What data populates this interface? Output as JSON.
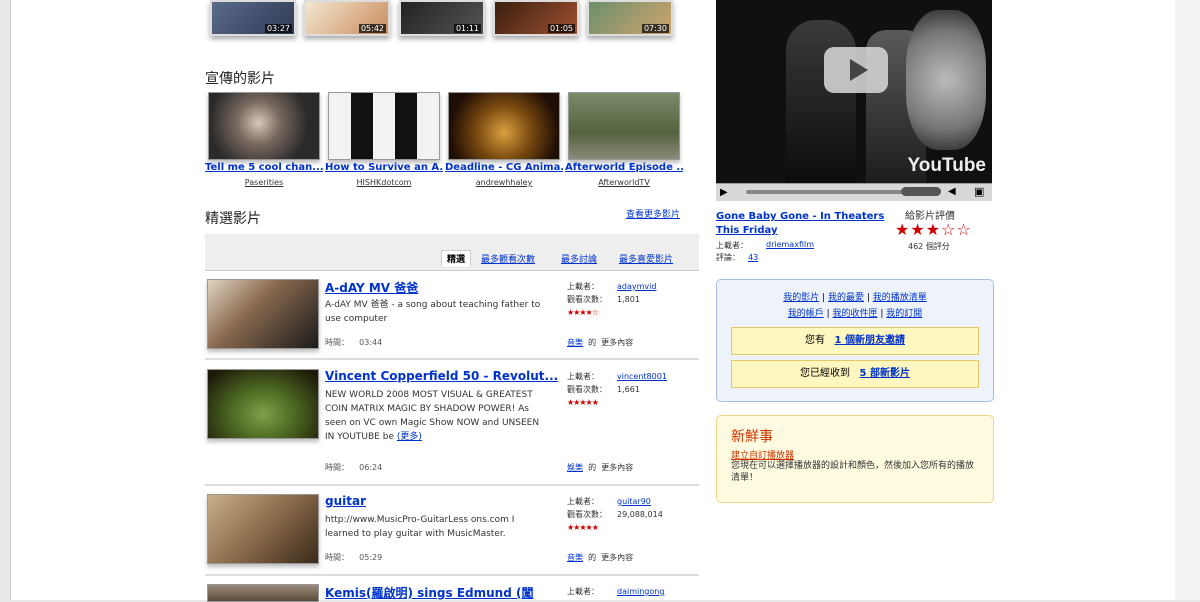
{
  "colors": {
    "link": "#0033cc",
    "star": "#cc0000",
    "accent_red": "#cc3300"
  },
  "top_strip": {
    "durations": [
      "03:27",
      "05:42",
      "01:11",
      "01:05",
      "07:30"
    ]
  },
  "promoted": {
    "title": "宣傳的影片",
    "items": [
      {
        "title": "Tell me 5 cool chan...",
        "user": "Paserities"
      },
      {
        "title": "How to Survive an A...",
        "user": "HISHKdotcom"
      },
      {
        "title": "Deadline - CG Anima...",
        "user": "andrewhhaley"
      },
      {
        "title": "Afterworld Episode ...",
        "user": "AfterworldTV"
      }
    ]
  },
  "featured": {
    "title": "精選影片",
    "see_more": "查看更多影片",
    "tabs": [
      "精選",
      "最多觀看次數",
      "最多討論",
      "最多喜愛影片"
    ],
    "labels": {
      "time": "時間：",
      "uploader": "上載者：",
      "views": "觀看次數：",
      "more": "更多內容",
      "of": "的"
    },
    "videos": [
      {
        "title": "A-dAY MV 爸爸",
        "desc": "A-dAY MV 爸爸 - a song about teaching father to use computer",
        "time": "03:44",
        "uploader": "adaymvid",
        "views": "1,801",
        "stars": "★★★★☆",
        "more_link": "音樂"
      },
      {
        "title": "Vincent Copperfield 50 - Revolut...",
        "desc": "NEW WORLD 2008 MOST VISUAL & GREATEST COIN MATRIX MAGIC BY SHADOW POWER! As seen on VC own Magic Show NOW and UNSEEN IN YOUTUBE be",
        "desc_more": "(更多)",
        "time": "06:24",
        "uploader": "vincent8001",
        "views": "1,661",
        "stars": "★★★★★",
        "more_link": "娛樂"
      },
      {
        "title": "guitar",
        "desc": "http://www.MusicPro-GuitarLess ons.com I learned to play guitar with MusicMaster.",
        "time": "05:29",
        "uploader": "guitar90",
        "views": "29,088,014",
        "stars": "★★★★★",
        "more_link": "音樂"
      },
      {
        "title": "Kemis(羅啟明) sings Edmund (闖",
        "uploader": "daimingong"
      }
    ]
  },
  "player": {
    "logo": "YouTube",
    "title": "Gone Baby Gone - In Theaters This Friday",
    "rate_label": "給影片評價",
    "stars": "★★★☆☆",
    "rating_count": "462 個評分",
    "uploader_label": "上載者：",
    "uploader": "driemaxfilm",
    "comments_label": "評論：",
    "comments": "43"
  },
  "account": {
    "links_row1": [
      "我的影片",
      "我的最愛",
      "我的播放清單"
    ],
    "links_row2": [
      "我的帳戶",
      "我的收件匣",
      "我的訂閱"
    ],
    "friend_prefix": "您有",
    "friend_link": "1 個新朋友邀請",
    "shared_prefix": "您已經收到",
    "shared_link": "5 部新影片"
  },
  "whats_new": {
    "title": "新鮮事",
    "link": "建立自訂播放器",
    "text": "您現在可以選擇播放器的設計和顏色，然後加入您所有的播放清單！"
  }
}
